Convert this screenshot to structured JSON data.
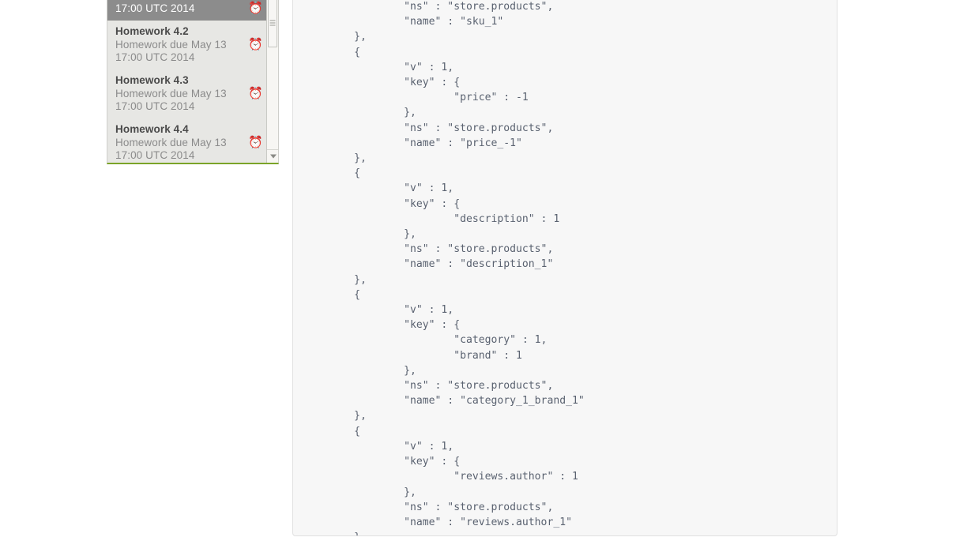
{
  "sidebar": {
    "scrollbar": {
      "thumb_name": "scrollbar-thumb",
      "down_arrow_label": "▼"
    },
    "items": [
      {
        "title": "",
        "due": "17:00 UTC 2014",
        "icon": "⏰",
        "icon_name": "alarm-clock-icon",
        "selected": true,
        "clipped": true
      },
      {
        "title": "Homework 4.2",
        "due": "Homework due May 13\n17:00 UTC 2014",
        "icon": "⏰",
        "icon_name": "alarm-clock-icon",
        "selected": false,
        "clipped": false
      },
      {
        "title": "Homework 4.3",
        "due": "Homework due May 13\n17:00 UTC 2014",
        "icon": "⏰",
        "icon_name": "alarm-clock-icon",
        "selected": false,
        "clipped": false
      },
      {
        "title": "Homework 4.4",
        "due": "Homework due May 13\n17:00 UTC 2014",
        "icon": "⏰",
        "icon_name": "alarm-clock-icon",
        "selected": false,
        "clipped": false
      }
    ]
  },
  "code_panel": {
    "language": "json",
    "content": "                \"ns\" : \"store.products\",\n                \"name\" : \"sku_1\"\n        },\n        {\n                \"v\" : 1,\n                \"key\" : {\n                        \"price\" : -1\n                },\n                \"ns\" : \"store.products\",\n                \"name\" : \"price_-1\"\n        },\n        {\n                \"v\" : 1,\n                \"key\" : {\n                        \"description\" : 1\n                },\n                \"ns\" : \"store.products\",\n                \"name\" : \"description_1\"\n        },\n        {\n                \"v\" : 1,\n                \"key\" : {\n                        \"category\" : 1,\n                        \"brand\" : 1\n                },\n                \"ns\" : \"store.products\",\n                \"name\" : \"category_1_brand_1\"\n        },\n        {\n                \"v\" : 1,\n                \"key\" : {\n                        \"reviews.author\" : 1\n                },\n                \"ns\" : \"store.products\",\n                \"name\" : \"reviews.author_1\"\n        }"
  },
  "colors": {
    "sidebar_bg": "#e7e7e4",
    "sidebar_selected_bg": "#8c8c8c",
    "sidebar_accent_green": "#7ba428",
    "icon_blue": "#14a5e0",
    "code_bg": "#f7f7f7",
    "code_text": "#5a6270"
  }
}
